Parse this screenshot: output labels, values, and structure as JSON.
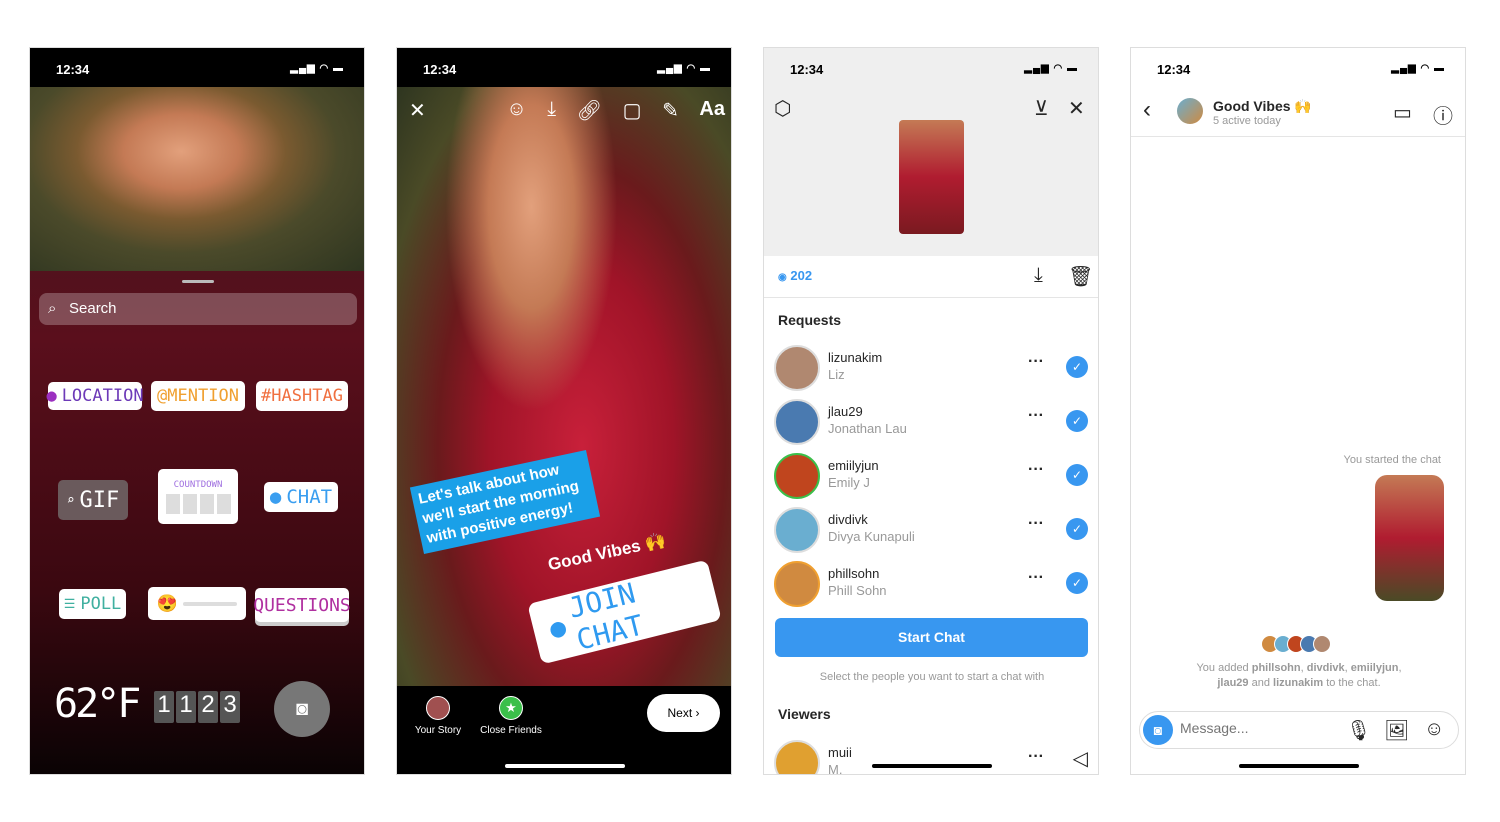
{
  "status_time": "12:34",
  "screen1": {
    "search_placeholder": "Search",
    "stickers": {
      "location": "LOCATION",
      "mention": "@MENTION",
      "hashtag": "#HASHTAG",
      "gif": "GIF",
      "countdown": "COUNTDOWN",
      "chat": "CHAT",
      "poll": "POLL",
      "questions": "QUESTIONS",
      "temperature": "62°F",
      "time_digits": [
        "1",
        "1",
        "2",
        "3"
      ]
    }
  },
  "screen2": {
    "question_text": "Let's talk about how we'll start the morning with positive energy!",
    "chat_name": "Good Vibes 🙌",
    "join_chat": "JOIN CHAT",
    "text_tool": "Aa",
    "your_story": "Your Story",
    "close_friends": "Close Friends",
    "next": "Next"
  },
  "screen3": {
    "view_count": "202",
    "requests_title": "Requests",
    "requests": [
      {
        "username": "lizunakim",
        "name": "Liz",
        "color": "#b08870"
      },
      {
        "username": "jlau29",
        "name": "Jonathan Lau",
        "color": "#4a7ab0"
      },
      {
        "username": "emiilyjun",
        "name": "Emily J",
        "color": "#c0451e"
      },
      {
        "username": "divdivk",
        "name": "Divya Kunapuli",
        "color": "#6aaed0"
      },
      {
        "username": "phillsohn",
        "name": "Phill Sohn",
        "color": "#d08a40"
      }
    ],
    "start_chat": "Start Chat",
    "hint": "Select the people you want to start a chat with",
    "viewers_title": "Viewers",
    "viewers": [
      {
        "username": "muii",
        "name": "M."
      }
    ]
  },
  "screen4": {
    "chat_title": "Good Vibes 🙌",
    "active": "5 active today",
    "started": "You started the chat",
    "added_prefix": "You added ",
    "added_users": [
      "phillsohn",
      "divdivk",
      "emiilyjun",
      "jlau29",
      "lizunakim"
    ],
    "sep1": ", ",
    "and": " and ",
    "added_suffix": " to the chat.",
    "message_placeholder": "Message..."
  },
  "colors": {
    "accent": "#3897f0",
    "chat_blue": "#2f9af0"
  }
}
